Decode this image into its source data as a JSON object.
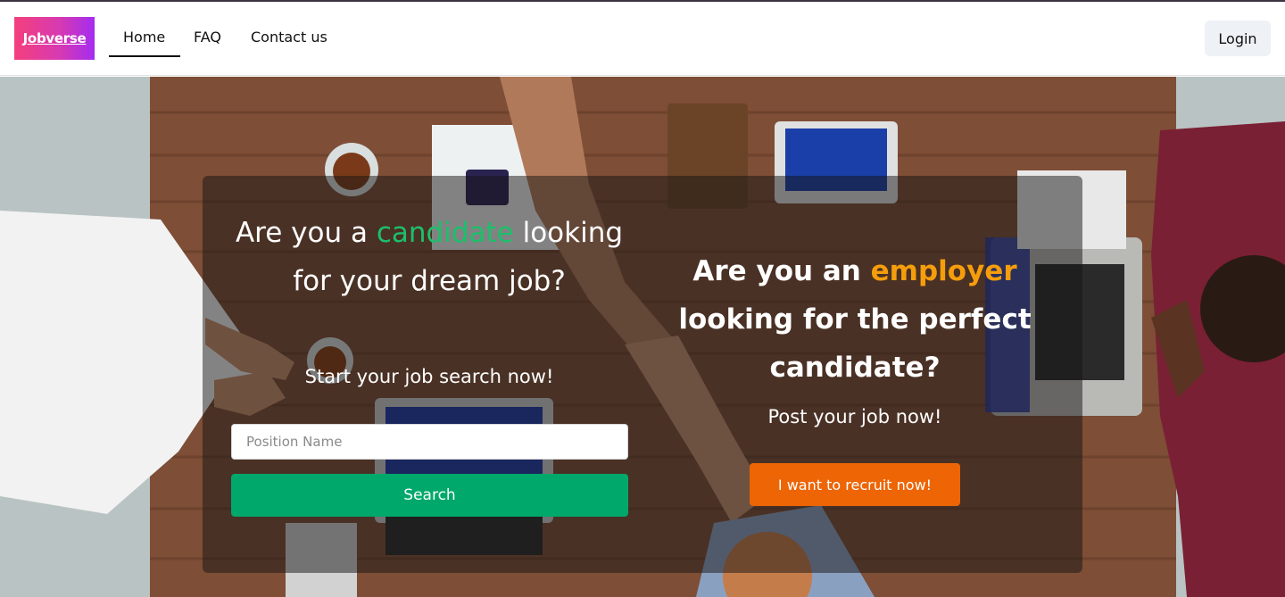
{
  "brand": {
    "logo_text": "Jobverse"
  },
  "nav": {
    "items": [
      {
        "label": "Home",
        "active": true
      },
      {
        "label": "FAQ",
        "active": false
      },
      {
        "label": "Contact us",
        "active": false
      }
    ],
    "login_label": "Login"
  },
  "hero": {
    "background_description_icon": "team-meeting-photo",
    "candidate": {
      "heading_prefix": "Are you a",
      "heading_accent": "candidate",
      "heading_rest": "looking for your dream job?",
      "subheading": "Start your job search now!",
      "search_placeholder": "Position Name",
      "search_value": "",
      "search_button": "Search"
    },
    "employer": {
      "heading_prefix": "Are you an",
      "heading_accent": "employer",
      "heading_rest": "looking for the perfect candidate?",
      "subheading": "Post your job now!",
      "recruit_button": "I want to recruit now!"
    }
  },
  "colors": {
    "logo_gradient_start": "#f43f7c",
    "logo_gradient_end": "#a52cf0",
    "candidate_accent": "#1cc06a",
    "employer_accent": "#f59d0b",
    "search_button": "#00a86b",
    "recruit_button": "#ed6505",
    "login_button_bg": "#eef1f5"
  }
}
